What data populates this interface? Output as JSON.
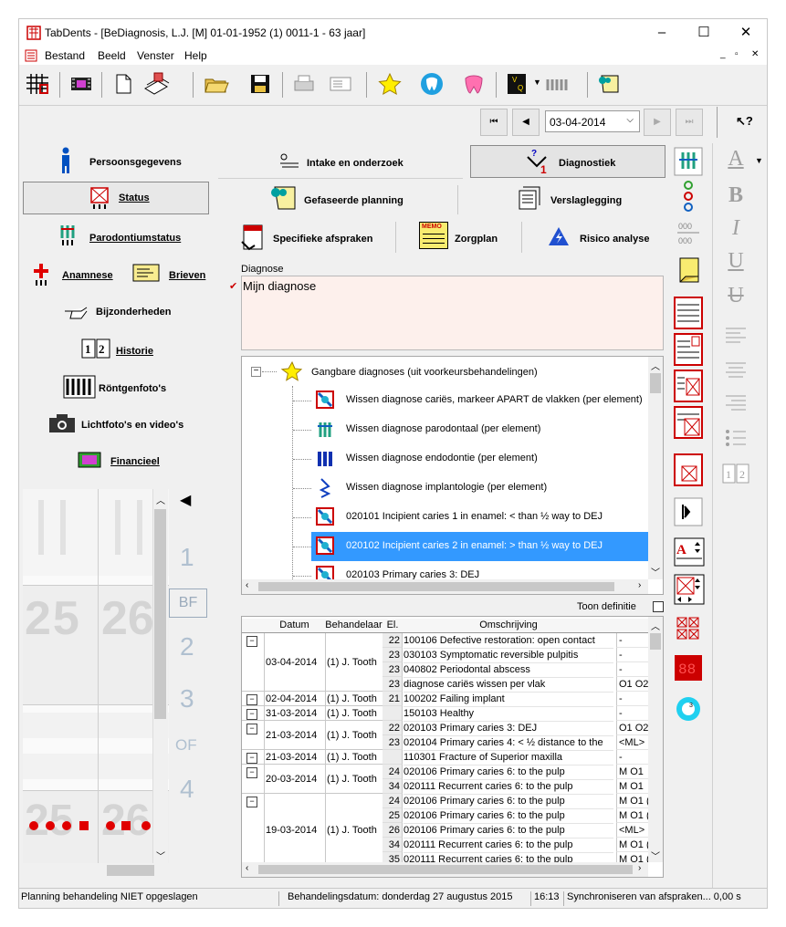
{
  "window": {
    "title": "TabDents - [BeDiagnosis, L.J. [M] 01-01-1952 (1) 0011-1 - 63 jaar]"
  },
  "menu": {
    "items": [
      "Bestand",
      "Beeld",
      "Venster",
      "Help"
    ]
  },
  "navigation": {
    "date": "03-04-2014"
  },
  "left_nav": {
    "persoonsgegevens": "Persoonsgegevens",
    "status": "Status",
    "parodontiumstatus": "Parodontiumstatus",
    "anamnese": "Anamnese",
    "brieven": "Brieven",
    "bijzonderheden": "Bijzonderheden",
    "historie": "Historie",
    "rontgenfotos": "Röntgenfoto's",
    "lichtfotos": "Lichtfoto's en video's",
    "financieel": "Financieel"
  },
  "tooth_chart": {
    "numbers": [
      "1",
      "BF",
      "2",
      "3",
      "OF",
      "4"
    ],
    "teeth": [
      "25",
      "26",
      "25",
      "26"
    ]
  },
  "tabs": {
    "intake": "Intake en onderzoek",
    "diagnostiek": "Diagnostiek",
    "planning": "Gefaseerde planning",
    "verslag": "Verslaglegging",
    "afspraken": "Specifieke afspraken",
    "zorgplan": "Zorgplan",
    "risico": "Risico analyse",
    "memo": "MEMO"
  },
  "diagnose": {
    "label": "Diagnose",
    "value": "Mijn diagnose"
  },
  "tree": {
    "root": "Gangbare diagnoses (uit voorkeursbehandelingen)",
    "items": [
      "Wissen diagnose cariës, markeer APART de vlakken (per element)",
      "Wissen diagnose parodontaal (per element)",
      "Wissen diagnose endodontie (per element)",
      "Wissen diagnose implantologie (per element)",
      "020101 Incipient caries 1 in enamel: < than ½ way to DEJ",
      "020102 Incipient caries 2 in enamel: > than ½ way to DEJ",
      "020103 Primary caries 3: DEJ"
    ],
    "selected_index": 5
  },
  "toon_definitie": "Toon definitie",
  "grid": {
    "headers": [
      "Datum",
      "Behandelaar",
      "El.",
      "Omschrijving",
      ""
    ],
    "rows": [
      {
        "date": "",
        "beh": "",
        "el": "22",
        "omschr": "100106 Defective restoration: open contact",
        "extra": "-"
      },
      {
        "date": "03-04-2014",
        "beh": "(1) J. Tooth",
        "el": "23",
        "omschr": "030103 Symptomatic reversible pulpitis",
        "extra": "-"
      },
      {
        "date": "",
        "beh": "",
        "el": "23",
        "omschr": "040802 Periodontal abscess",
        "extra": "-"
      },
      {
        "date": "",
        "beh": "",
        "el": "23",
        "omschr": "diagnose cariës wissen per vlak",
        "extra": "O1 O2"
      },
      {
        "date": "02-04-2014",
        "beh": "(1) J. Tooth",
        "el": "21",
        "omschr": "100202 Failing implant",
        "extra": "-"
      },
      {
        "date": "31-03-2014",
        "beh": "(1) J. Tooth",
        "el": "",
        "omschr": "150103 Healthy",
        "extra": "-"
      },
      {
        "date": "",
        "beh": "",
        "el": "22",
        "omschr": "020103 Primary caries 3: DEJ",
        "extra": "O1 O2"
      },
      {
        "date": "21-03-2014",
        "beh": "(1) J. Tooth",
        "el": "23",
        "omschr": "020104 Primary caries 4: < ½ distance to the",
        "extra": "<ML>"
      },
      {
        "date": "21-03-2014",
        "beh": "(1) J. Tooth",
        "el": "",
        "omschr": "110301 Fracture of Superior maxilla",
        "extra": "-"
      },
      {
        "date": "",
        "beh": "",
        "el": "24",
        "omschr": "020106 Primary caries 6: to the pulp",
        "extra": "M O1"
      },
      {
        "date": "20-03-2014",
        "beh": "(1) J. Tooth",
        "el": "34",
        "omschr": "020111 Recurrent caries 6: to the pulp",
        "extra": "M O1"
      },
      {
        "date": "",
        "beh": "",
        "el": "24",
        "omschr": "020106 Primary caries 6: to the pulp",
        "extra": "M O1 ("
      },
      {
        "date": "",
        "beh": "",
        "el": "25",
        "omschr": "020106 Primary caries 6: to the pulp",
        "extra": "M O1 ("
      },
      {
        "date": "19-03-2014",
        "beh": "(1) J. Tooth",
        "el": "26",
        "omschr": "020106 Primary caries 6: to the pulp",
        "extra": "<ML>"
      },
      {
        "date": "",
        "beh": "",
        "el": "34",
        "omschr": "020111 Recurrent caries 6: to the pulp",
        "extra": "M O1 ("
      },
      {
        "date": "",
        "beh": "",
        "el": "35",
        "omschr": "020111 Recurrent caries 6: to the pulp",
        "extra": "M O1 ("
      }
    ]
  },
  "status": {
    "left": "Planning behandeling NIET opgeslagen",
    "date": "Behandelingsdatum: donderdag 27 augustus 2015",
    "time": "16:13",
    "sync": "Synchroniseren van afspraken... 0,00 s"
  },
  "colors": {
    "selection": "#3399ff",
    "diag_bg": "#fdf0ec",
    "accent_red": "#cc0000"
  }
}
